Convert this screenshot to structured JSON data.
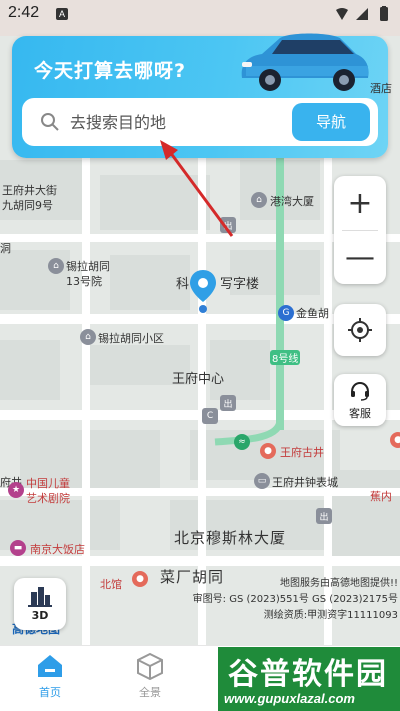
{
  "status_bar": {
    "time": "2:42",
    "indicator": "A"
  },
  "search_card": {
    "title": "今天打算去哪呀?",
    "search_placeholder": "去搜索目的地",
    "nav_label": "导航"
  },
  "map": {
    "labels": [
      {
        "text": "王府井大街",
        "cls": "small"
      },
      {
        "text": "九胡同9号",
        "cls": "small"
      },
      {
        "text": "港湾大厦",
        "cls": "small"
      },
      {
        "text": "锡拉胡同",
        "cls": "small"
      },
      {
        "text": "13号院",
        "cls": "small"
      },
      {
        "text": "科",
        "cls": "med"
      },
      {
        "text": "写字楼",
        "cls": "med"
      },
      {
        "text": "金鱼胡",
        "cls": "small"
      },
      {
        "text": "锡拉胡同小区",
        "cls": "small"
      },
      {
        "text": "8号线",
        "cls": "tiny"
      },
      {
        "text": "王府中心",
        "cls": "med"
      },
      {
        "text": "王府古井",
        "cls": "small red"
      },
      {
        "text": "中国儿童",
        "cls": "small red"
      },
      {
        "text": "艺术剧院",
        "cls": "small red"
      },
      {
        "text": "王府井钟表城",
        "cls": "small"
      },
      {
        "text": "蕉内",
        "cls": "small red"
      },
      {
        "text": "北京穆斯林大厦",
        "cls": "big"
      },
      {
        "text": "南京大饭店",
        "cls": "small red"
      },
      {
        "text": "北馆",
        "cls": "small red"
      },
      {
        "text": "菜厂胡同",
        "cls": "big"
      },
      {
        "text": "酒店",
        "cls": "small"
      },
      {
        "text": "府井",
        "cls": "small"
      },
      {
        "text": "洞",
        "cls": "small"
      }
    ],
    "copyright_lines": [
      "地图服务由高德地图提供!!",
      "审图号: GS (2023)551号 GS (2023)2175号",
      "测绘资质:甲测资字11111093"
    ],
    "provider_logo": "高德地图"
  },
  "controls": {
    "zoom_in": "+",
    "zoom_out": "—",
    "service_label": "客服",
    "three_d_label": "3D"
  },
  "tabs": [
    {
      "label": "首页",
      "icon": "home-icon"
    },
    {
      "label": "全景",
      "icon": "cube-icon"
    }
  ],
  "watermark": {
    "title": "谷普软件园",
    "url": "www.gupuxlazal.com"
  },
  "colors": {
    "accent": "#39b3ee",
    "tab_active": "#2e9de8",
    "pin": "#2f9fe6",
    "metro": "#3fbf84"
  }
}
